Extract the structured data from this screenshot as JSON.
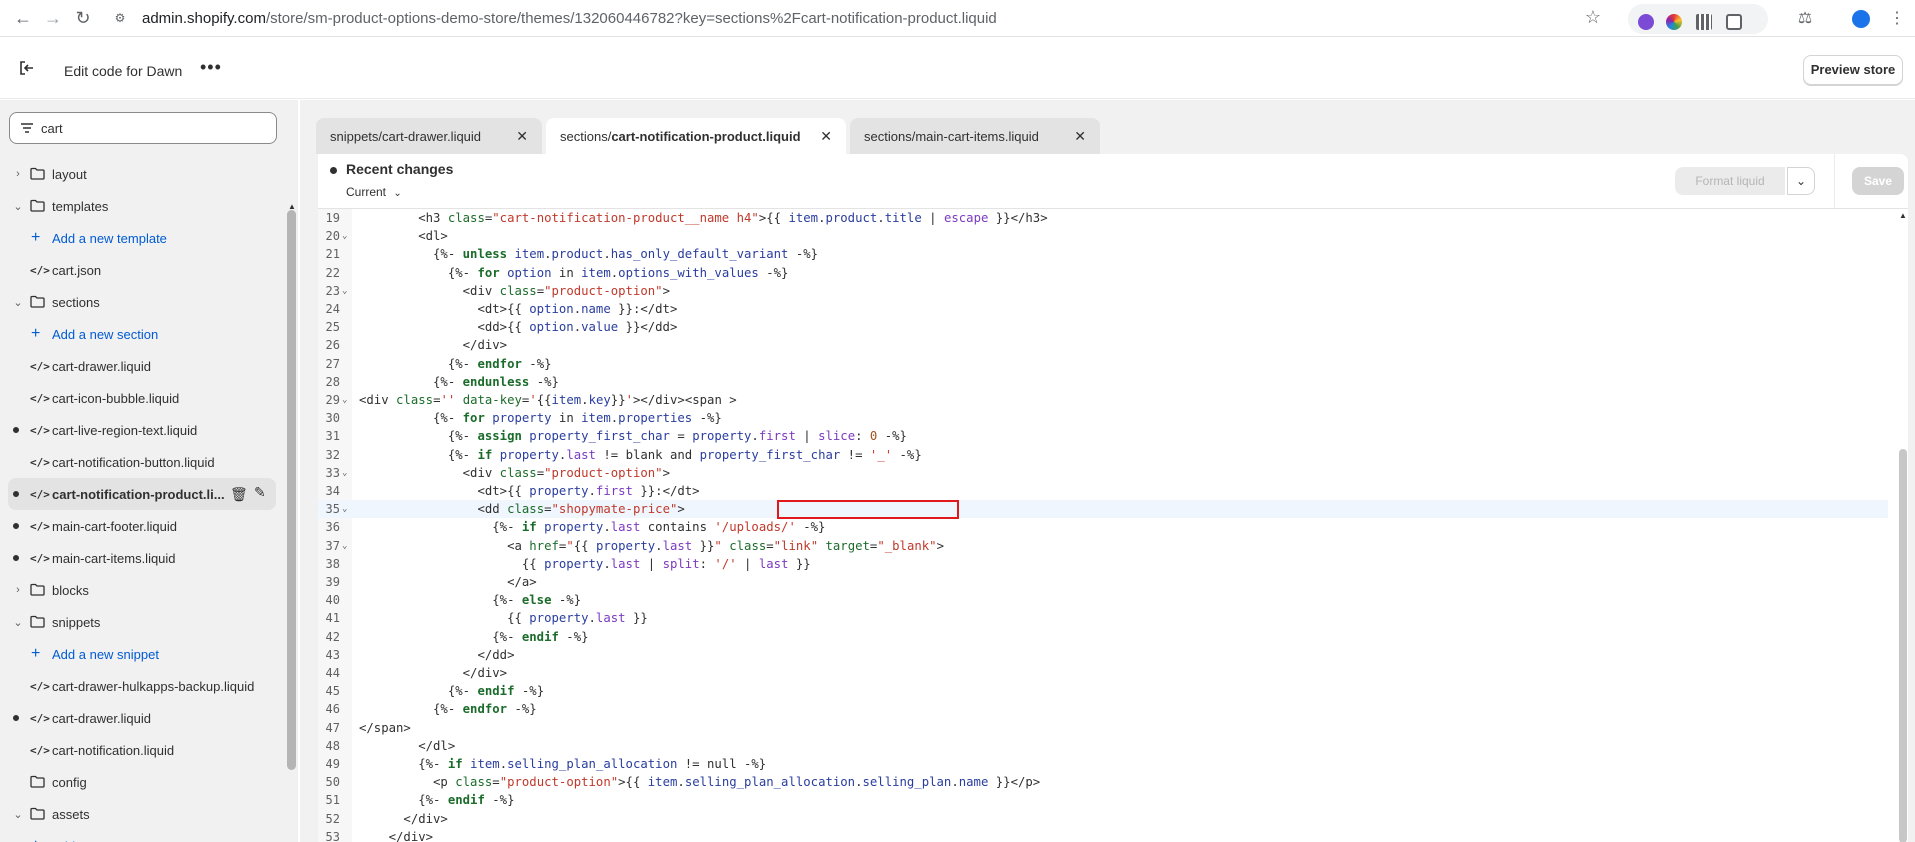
{
  "browser": {
    "url_host": "admin.shopify.com",
    "url_path": "/store/sm-product-options-demo-store/themes/132060446782?key=sections%2Fcart-notification-product.liquid"
  },
  "header": {
    "title": "Edit code for Dawn",
    "preview_label": "Preview store"
  },
  "sidebar": {
    "search_value": "cart",
    "items": [
      {
        "kind": "folder",
        "label": "layout",
        "expanded": false
      },
      {
        "kind": "folder",
        "label": "templates",
        "expanded": true
      },
      {
        "kind": "add",
        "label": "Add a new template"
      },
      {
        "kind": "file",
        "label": "cart.json",
        "modified": false
      },
      {
        "kind": "folder",
        "label": "sections",
        "expanded": true
      },
      {
        "kind": "add",
        "label": "Add a new section"
      },
      {
        "kind": "file",
        "label": "cart-drawer.liquid",
        "modified": false
      },
      {
        "kind": "file",
        "label": "cart-icon-bubble.liquid",
        "modified": false
      },
      {
        "kind": "file",
        "label": "cart-live-region-text.liquid",
        "modified": true
      },
      {
        "kind": "file",
        "label": "cart-notification-button.liquid",
        "modified": false
      },
      {
        "kind": "file",
        "label": "cart-notification-product.li...",
        "modified": true,
        "selected": true
      },
      {
        "kind": "file",
        "label": "main-cart-footer.liquid",
        "modified": true
      },
      {
        "kind": "file",
        "label": "main-cart-items.liquid",
        "modified": true
      },
      {
        "kind": "folder",
        "label": "blocks",
        "expanded": false
      },
      {
        "kind": "folder",
        "label": "snippets",
        "expanded": true
      },
      {
        "kind": "add",
        "label": "Add a new snippet"
      },
      {
        "kind": "file",
        "label": "cart-drawer-hulkapps-backup.liquid",
        "modified": false
      },
      {
        "kind": "file",
        "label": "cart-drawer.liquid",
        "modified": true
      },
      {
        "kind": "file",
        "label": "cart-notification.liquid",
        "modified": false
      },
      {
        "kind": "folder",
        "label": "config",
        "expanded": false,
        "no_chevron": true
      },
      {
        "kind": "folder",
        "label": "assets",
        "expanded": true
      },
      {
        "kind": "add",
        "label": "Add a new asset"
      }
    ]
  },
  "tabs": [
    {
      "prefix": "snippets/",
      "name": "cart-drawer.liquid",
      "active": false
    },
    {
      "prefix": "sections/",
      "name": "cart-notification-product.liquid",
      "active": true
    },
    {
      "prefix": "sections/",
      "name": "main-cart-items.liquid",
      "active": false
    }
  ],
  "panel": {
    "recent_title": "Recent changes",
    "current_label": "Current",
    "format_label": "Format liquid",
    "save_label": "Save"
  },
  "code": {
    "highlight_line": 35,
    "lines": [
      {
        "n": "19",
        "fold": false,
        "html": "        &lt;h3 <span class='c-attr'>class</span>=<span class='c-str'>\"cart-notification-product__name h4\"</span>&gt;{{ <span class='c-var'>item</span>.<span class='c-var'>product</span>.<span class='c-var'>title</span> | <span class='c-filter'>escape</span> }}&lt;/h3&gt;"
      },
      {
        "n": "20",
        "fold": true,
        "html": "        &lt;dl&gt;"
      },
      {
        "n": "21",
        "fold": false,
        "html": "          {%- <span class='c-kw'>unless</span> <span class='c-var'>item</span>.<span class='c-var'>product</span>.<span class='c-var'>has_only_default_variant</span> -%}"
      },
      {
        "n": "22",
        "fold": false,
        "html": "            {%- <span class='c-kw'>for</span> <span class='c-var'>option</span> in <span class='c-var'>item</span>.<span class='c-var'>options_with_values</span> -%}"
      },
      {
        "n": "23",
        "fold": true,
        "html": "              &lt;div <span class='c-attr'>class</span>=<span class='c-str'>\"product-option\"</span>&gt;"
      },
      {
        "n": "24",
        "fold": false,
        "html": "                &lt;dt&gt;{{ <span class='c-var'>option</span>.<span class='c-var'>name</span> }}:&lt;/dt&gt;"
      },
      {
        "n": "25",
        "fold": false,
        "html": "                &lt;dd&gt;{{ <span class='c-var'>option</span>.<span class='c-var'>value</span> }}&lt;/dd&gt;"
      },
      {
        "n": "26",
        "fold": false,
        "html": "              &lt;/div&gt;"
      },
      {
        "n": "27",
        "fold": false,
        "html": "            {%- <span class='c-kw'>endfor</span> -%}"
      },
      {
        "n": "28",
        "fold": false,
        "html": "          {%- <span class='c-kw'>endunless</span> -%}"
      },
      {
        "n": "29",
        "fold": true,
        "html": "&lt;div <span class='c-attr'>class</span>=<span class='c-str'>''</span> <span class='c-attr'>data-key</span>=<span class='c-str'>'</span>{{<span class='c-var'>item</span>.<span class='c-var'>key</span>}}<span class='c-str'>'</span>&gt;&lt;/div&gt;&lt;span &gt;"
      },
      {
        "n": "30",
        "fold": false,
        "html": "          {%- <span class='c-kw'>for</span> <span class='c-var'>property</span> in <span class='c-var'>item</span>.<span class='c-var'>properties</span> -%}"
      },
      {
        "n": "31",
        "fold": false,
        "html": "            {%- <span class='c-kw'>assign</span> <span class='c-var'>property_first_char</span> = <span class='c-var'>property</span>.<span class='c-prop'>first</span> | <span class='c-filter'>slice</span>: <span class='c-num'>0</span> -%}"
      },
      {
        "n": "32",
        "fold": false,
        "html": "            {%- <span class='c-kw'>if</span> <span class='c-var'>property</span>.<span class='c-prop'>last</span> != blank and <span class='c-var'>property_first_char</span> != <span class='c-str'>'_'</span> -%}"
      },
      {
        "n": "33",
        "fold": true,
        "html": "              &lt;div <span class='c-attr'>class</span>=<span class='c-str'>\"product-option\"</span>&gt;"
      },
      {
        "n": "34",
        "fold": false,
        "html": "                &lt;dt&gt;{{ <span class='c-var'>property</span>.<span class='c-prop'>first</span> }}:&lt;/dt&gt;"
      },
      {
        "n": "35",
        "fold": true,
        "html": "                &lt;dd <span class='c-attr'>class</span>=<span class='c-str'>\"shopymate-price\"</span>&gt;"
      },
      {
        "n": "36",
        "fold": false,
        "html": "                  {%- <span class='c-kw'>if</span> <span class='c-var'>property</span>.<span class='c-prop'>last</span> contains <span class='c-str'>'/uploads/'</span> -%}"
      },
      {
        "n": "37",
        "fold": true,
        "html": "                    &lt;a <span class='c-attr'>href</span>=<span class='c-str'>\"</span>{{ <span class='c-var'>property</span>.<span class='c-prop'>last</span> }}<span class='c-str'>\"</span> <span class='c-attr'>class</span>=<span class='c-str'>\"link\"</span> <span class='c-attr'>target</span>=<span class='c-str'>\"_blank\"</span>&gt;"
      },
      {
        "n": "38",
        "fold": false,
        "html": "                      {{ <span class='c-var'>property</span>.<span class='c-prop'>last</span> | <span class='c-filter'>split</span>: <span class='c-str'>'/'</span> | <span class='c-filter'>last</span> }}"
      },
      {
        "n": "39",
        "fold": false,
        "html": "                    &lt;/a&gt;"
      },
      {
        "n": "40",
        "fold": false,
        "html": "                  {%- <span class='c-kw'>else</span> -%}"
      },
      {
        "n": "41",
        "fold": false,
        "html": "                    {{ <span class='c-var'>property</span>.<span class='c-prop'>last</span> }}"
      },
      {
        "n": "42",
        "fold": false,
        "html": "                  {%- <span class='c-kw'>endif</span> -%}"
      },
      {
        "n": "43",
        "fold": false,
        "html": "                &lt;/dd&gt;"
      },
      {
        "n": "44",
        "fold": false,
        "html": "              &lt;/div&gt;"
      },
      {
        "n": "45",
        "fold": false,
        "html": "            {%- <span class='c-kw'>endif</span> -%}"
      },
      {
        "n": "46",
        "fold": false,
        "html": "          {%- <span class='c-kw'>endfor</span> -%}"
      },
      {
        "n": "47",
        "fold": false,
        "html": "&lt;/span&gt;"
      },
      {
        "n": "48",
        "fold": false,
        "html": "        &lt;/dl&gt;"
      },
      {
        "n": "49",
        "fold": false,
        "html": "        {%- <span class='c-kw'>if</span> <span class='c-var'>item</span>.<span class='c-var'>selling_plan_allocation</span> != null -%}"
      },
      {
        "n": "50",
        "fold": false,
        "html": "          &lt;p <span class='c-attr'>class</span>=<span class='c-str'>\"product-option\"</span>&gt;{{ <span class='c-var'>item</span>.<span class='c-var'>selling_plan_allocation</span>.<span class='c-var'>selling_plan</span>.<span class='c-var'>name</span> }}&lt;/p&gt;"
      },
      {
        "n": "51",
        "fold": false,
        "html": "        {%- <span class='c-kw'>endif</span> -%}"
      },
      {
        "n": "52",
        "fold": false,
        "html": "      &lt;/div&gt;"
      },
      {
        "n": "53",
        "fold": false,
        "html": "    &lt;/div&gt;"
      }
    ]
  }
}
